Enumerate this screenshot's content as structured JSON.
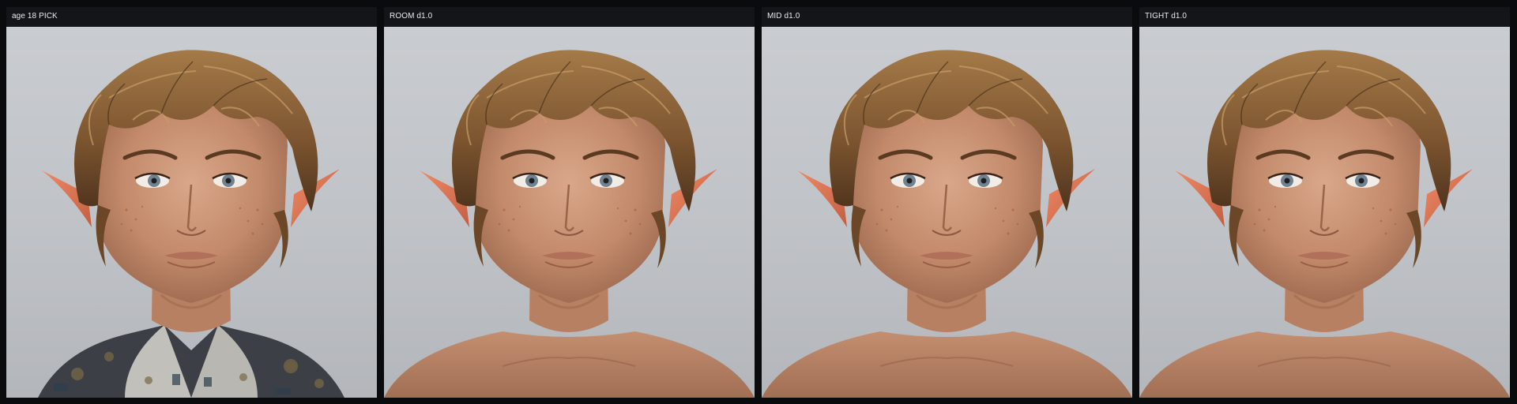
{
  "panels": [
    {
      "label": "age 18 PICK",
      "image": "elf-portrait-clothed"
    },
    {
      "label": "ROOM d1.0",
      "image": "elf-portrait-bare-shoulders"
    },
    {
      "label": "MID d1.0",
      "image": "elf-portrait-bare-shoulders"
    },
    {
      "label": "TIGHT d1.0",
      "image": "elf-portrait-bare-shoulders"
    }
  ],
  "colors": {
    "page_background": "#0a0b0d",
    "header_background": "#141519",
    "header_text": "#e9eaec",
    "portrait_background": "#c4c7cb",
    "hair": "#8a6234",
    "skin": "#c99273",
    "ear": "#e07856"
  }
}
